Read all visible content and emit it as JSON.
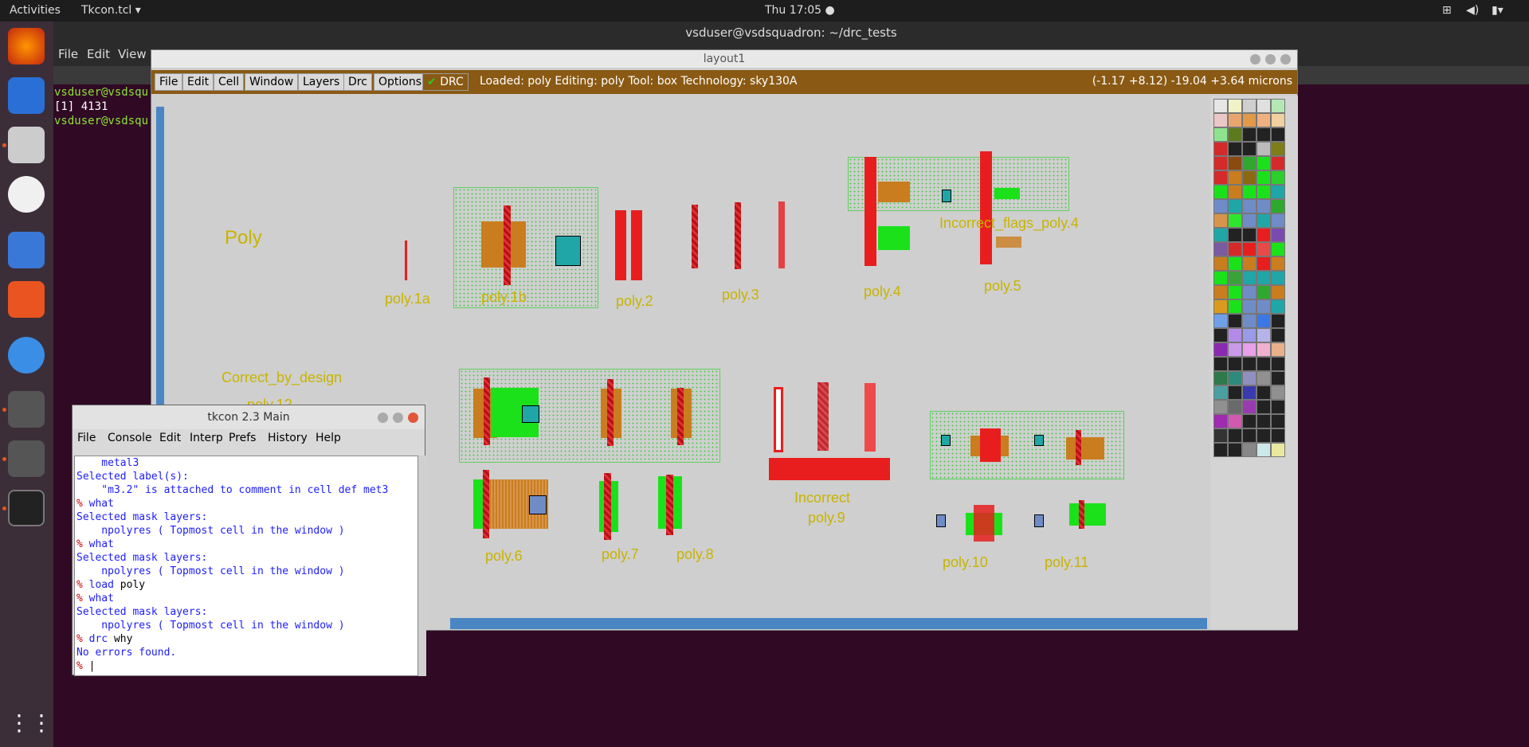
{
  "topbar": {
    "activities": "Activities",
    "app": "Tkcon.tcl ▾",
    "clock": "Thu 17:05 ●"
  },
  "terminal": {
    "title": "vsduser@vsdsquadron: ~/drc_tests",
    "menu": [
      "File",
      "Edit",
      "View"
    ],
    "lines": [
      "vsduser@vsdsqu",
      "[1] 4131",
      "vsduser@vsdsqu"
    ]
  },
  "layout": {
    "title": "layout1",
    "menu": [
      "File",
      "Edit",
      "Cell",
      "Window",
      "Layers",
      "Drc",
      "Options"
    ],
    "drc": "DRC",
    "status": "Loaded: poly Editing: poly Tool: box  Technology: sky130A",
    "coords": "(-1.17 +8.12) -19.04 +3.64 microns"
  },
  "cell_labels": {
    "poly": "Poly",
    "p1a": "poly.1a",
    "p1b": "poly.1b",
    "p2": "poly.2",
    "p3": "poly.3",
    "p4": "poly.4",
    "p5": "poly.5",
    "incflags": "Incorrect_flags_poly.4",
    "cbd": "Correct_by_design",
    "p12": "poly.12",
    "p6": "poly.6",
    "p7": "poly.7",
    "p8": "poly.8",
    "inc": "Incorrect",
    "p9": "poly.9",
    "p10": "poly.10",
    "p11": "poly.11"
  },
  "tkcon": {
    "title": "tkcon 2.3 Main",
    "menu": [
      "File",
      "Console",
      "Edit",
      "Interp",
      "Prefs",
      "History",
      "Help"
    ],
    "lines": [
      {
        "t": "    metal3",
        "c": "blue"
      },
      {
        "t": "Selected label(s):",
        "c": "blue"
      },
      {
        "t": "    \"m3.2\" is attached to comment in cell def met3",
        "c": "blue"
      },
      {
        "t": "% what",
        "c": "cmd"
      },
      {
        "t": "Selected mask layers:",
        "c": "blue"
      },
      {
        "t": "    npolyres ( Topmost cell in the window )",
        "c": "blue"
      },
      {
        "t": "% what",
        "c": "cmd"
      },
      {
        "t": "Selected mask layers:",
        "c": "blue"
      },
      {
        "t": "    npolyres ( Topmost cell in the window )",
        "c": "blue"
      },
      {
        "t": "% load poly",
        "c": "cmd"
      },
      {
        "t": "% what",
        "c": "cmd"
      },
      {
        "t": "Selected mask layers:",
        "c": "blue"
      },
      {
        "t": "    npolyres ( Topmost cell in the window )",
        "c": "blue"
      },
      {
        "t": "% drc why",
        "c": "cmd"
      },
      {
        "t": "No errors found.",
        "c": "blue"
      },
      {
        "t": "% ",
        "c": "cmd"
      }
    ]
  }
}
